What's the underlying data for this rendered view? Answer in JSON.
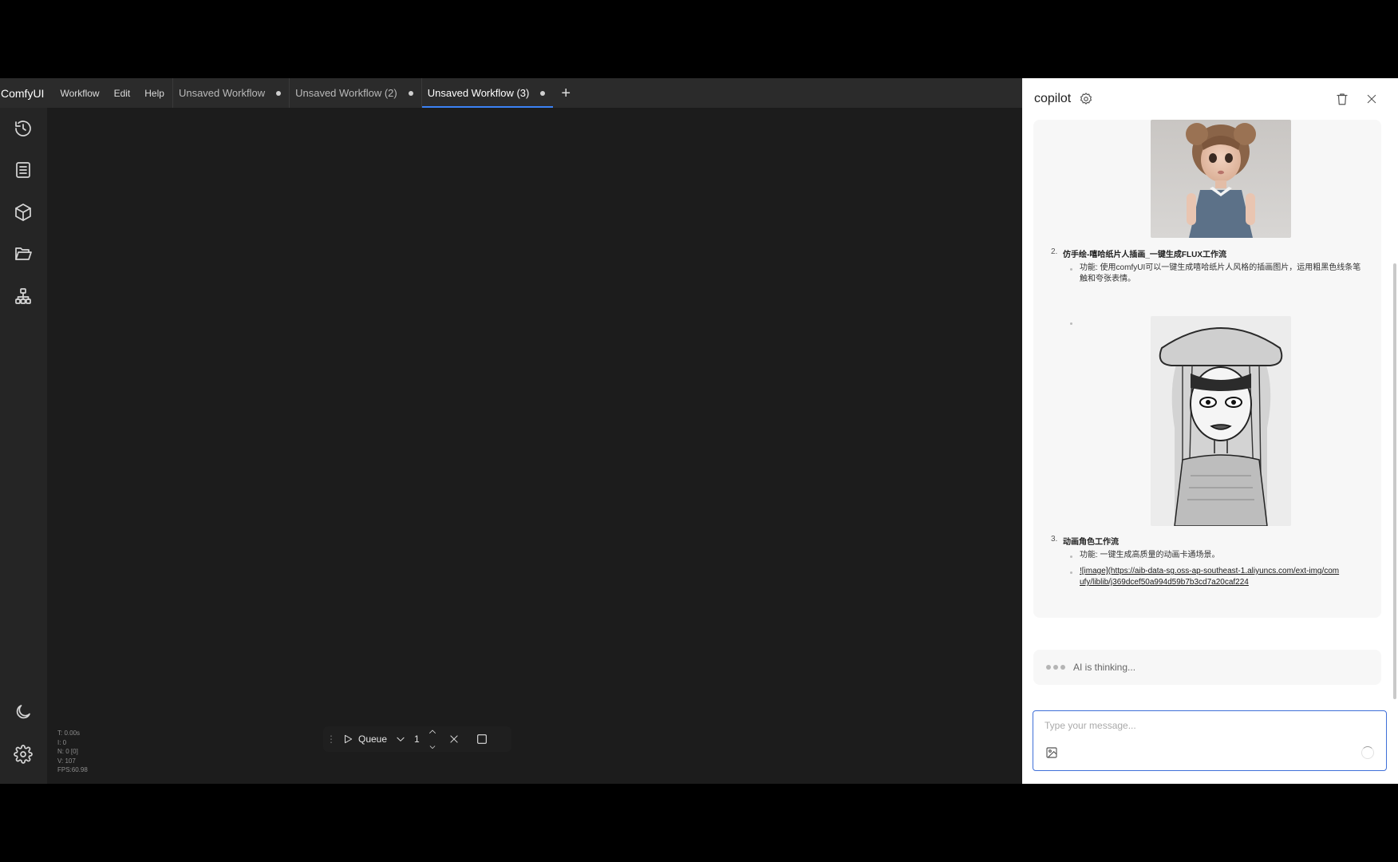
{
  "topbar": {
    "logo": "ComfyUI",
    "menu": [
      "Workflow",
      "Edit",
      "Help"
    ],
    "tabs": [
      {
        "label": "Unsaved Workflow",
        "active": false
      },
      {
        "label": "Unsaved Workflow (2)",
        "active": false
      },
      {
        "label": "Unsaved Workflow (3)",
        "active": true
      }
    ]
  },
  "sidebar": {
    "icons": [
      "history-icon",
      "queue-list-icon",
      "model-cube-icon",
      "workflows-folder-icon",
      "node-library-icon",
      "theme-moon-icon",
      "settings-gear-icon"
    ]
  },
  "canvas": {
    "stats": [
      "T: 0.00s",
      "I: 0",
      "N: 0 [0]",
      "V: 107",
      "FPS:60.98"
    ]
  },
  "queue": {
    "label": "Queue",
    "count": "1"
  },
  "copilot": {
    "title": "copilot",
    "items": [
      {
        "num": "2.",
        "title": "仿手绘-嘻哈纸片人插画_一键生成FLUX工作流",
        "desc": "功能: 使用comfyUI可以一键生成嘻哈纸片人风格的插画图片，运用粗黑色线条笔触和夸张表情。"
      },
      {
        "num": "3.",
        "title": "动画角色工作流",
        "desc": "功能: 一键生成高质量的动画卡通场景。",
        "link": "![image](https://aib-data-sg.oss-ap-southeast-1.aliyuncs.com/ext-img/comufy/liblib/j369dcef50a994d59b7b3cd7a20caf224"
      }
    ],
    "thinking": "AI is thinking...",
    "input_placeholder": "Type your message..."
  }
}
